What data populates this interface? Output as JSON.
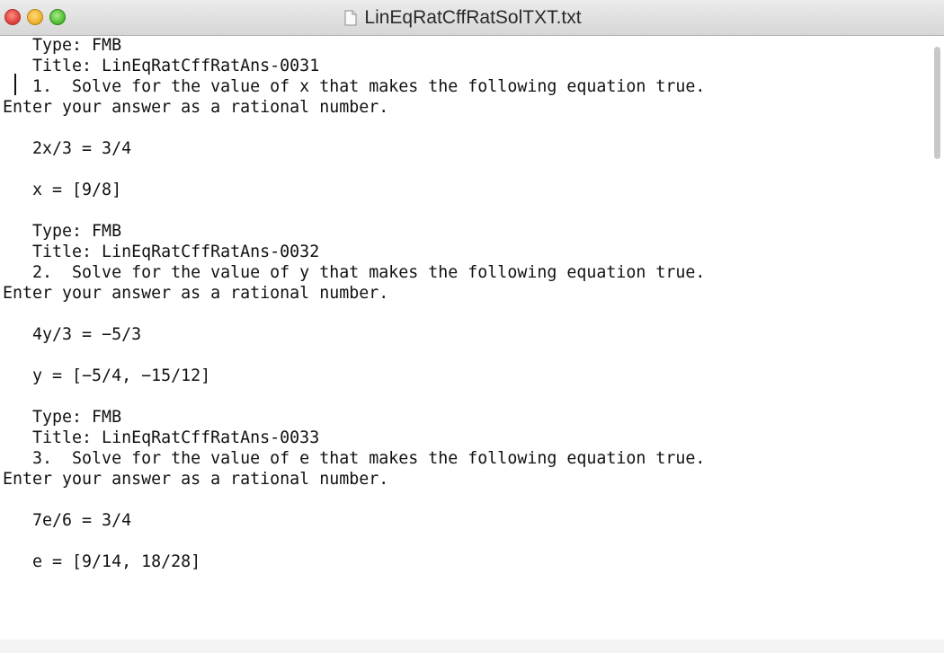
{
  "window": {
    "title": "LinEqRatCffRatSolTXT.txt"
  },
  "document": {
    "lines": [
      "   Type: FMB",
      "   Title: LinEqRatCffRatAns-0031",
      "   1.  Solve for the value of x that makes the following equation true.",
      "Enter your answer as a rational number.",
      "",
      "   2x/3 = 3/4",
      "",
      "   x = [9/8]",
      "",
      "   Type: FMB",
      "   Title: LinEqRatCffRatAns-0032",
      "   2.  Solve for the value of y that makes the following equation true.",
      "Enter your answer as a rational number.",
      "",
      "   4y/3 = −5/3",
      "",
      "   y = [−5/4, −15/12]",
      "",
      "   Type: FMB",
      "   Title: LinEqRatCffRatAns-0033",
      "   3.  Solve for the value of e that makes the following equation true.",
      "Enter your answer as a rational number.",
      "",
      "   7e/6 = 3/4",
      "",
      "   e = [9/14, 18/28]"
    ]
  }
}
